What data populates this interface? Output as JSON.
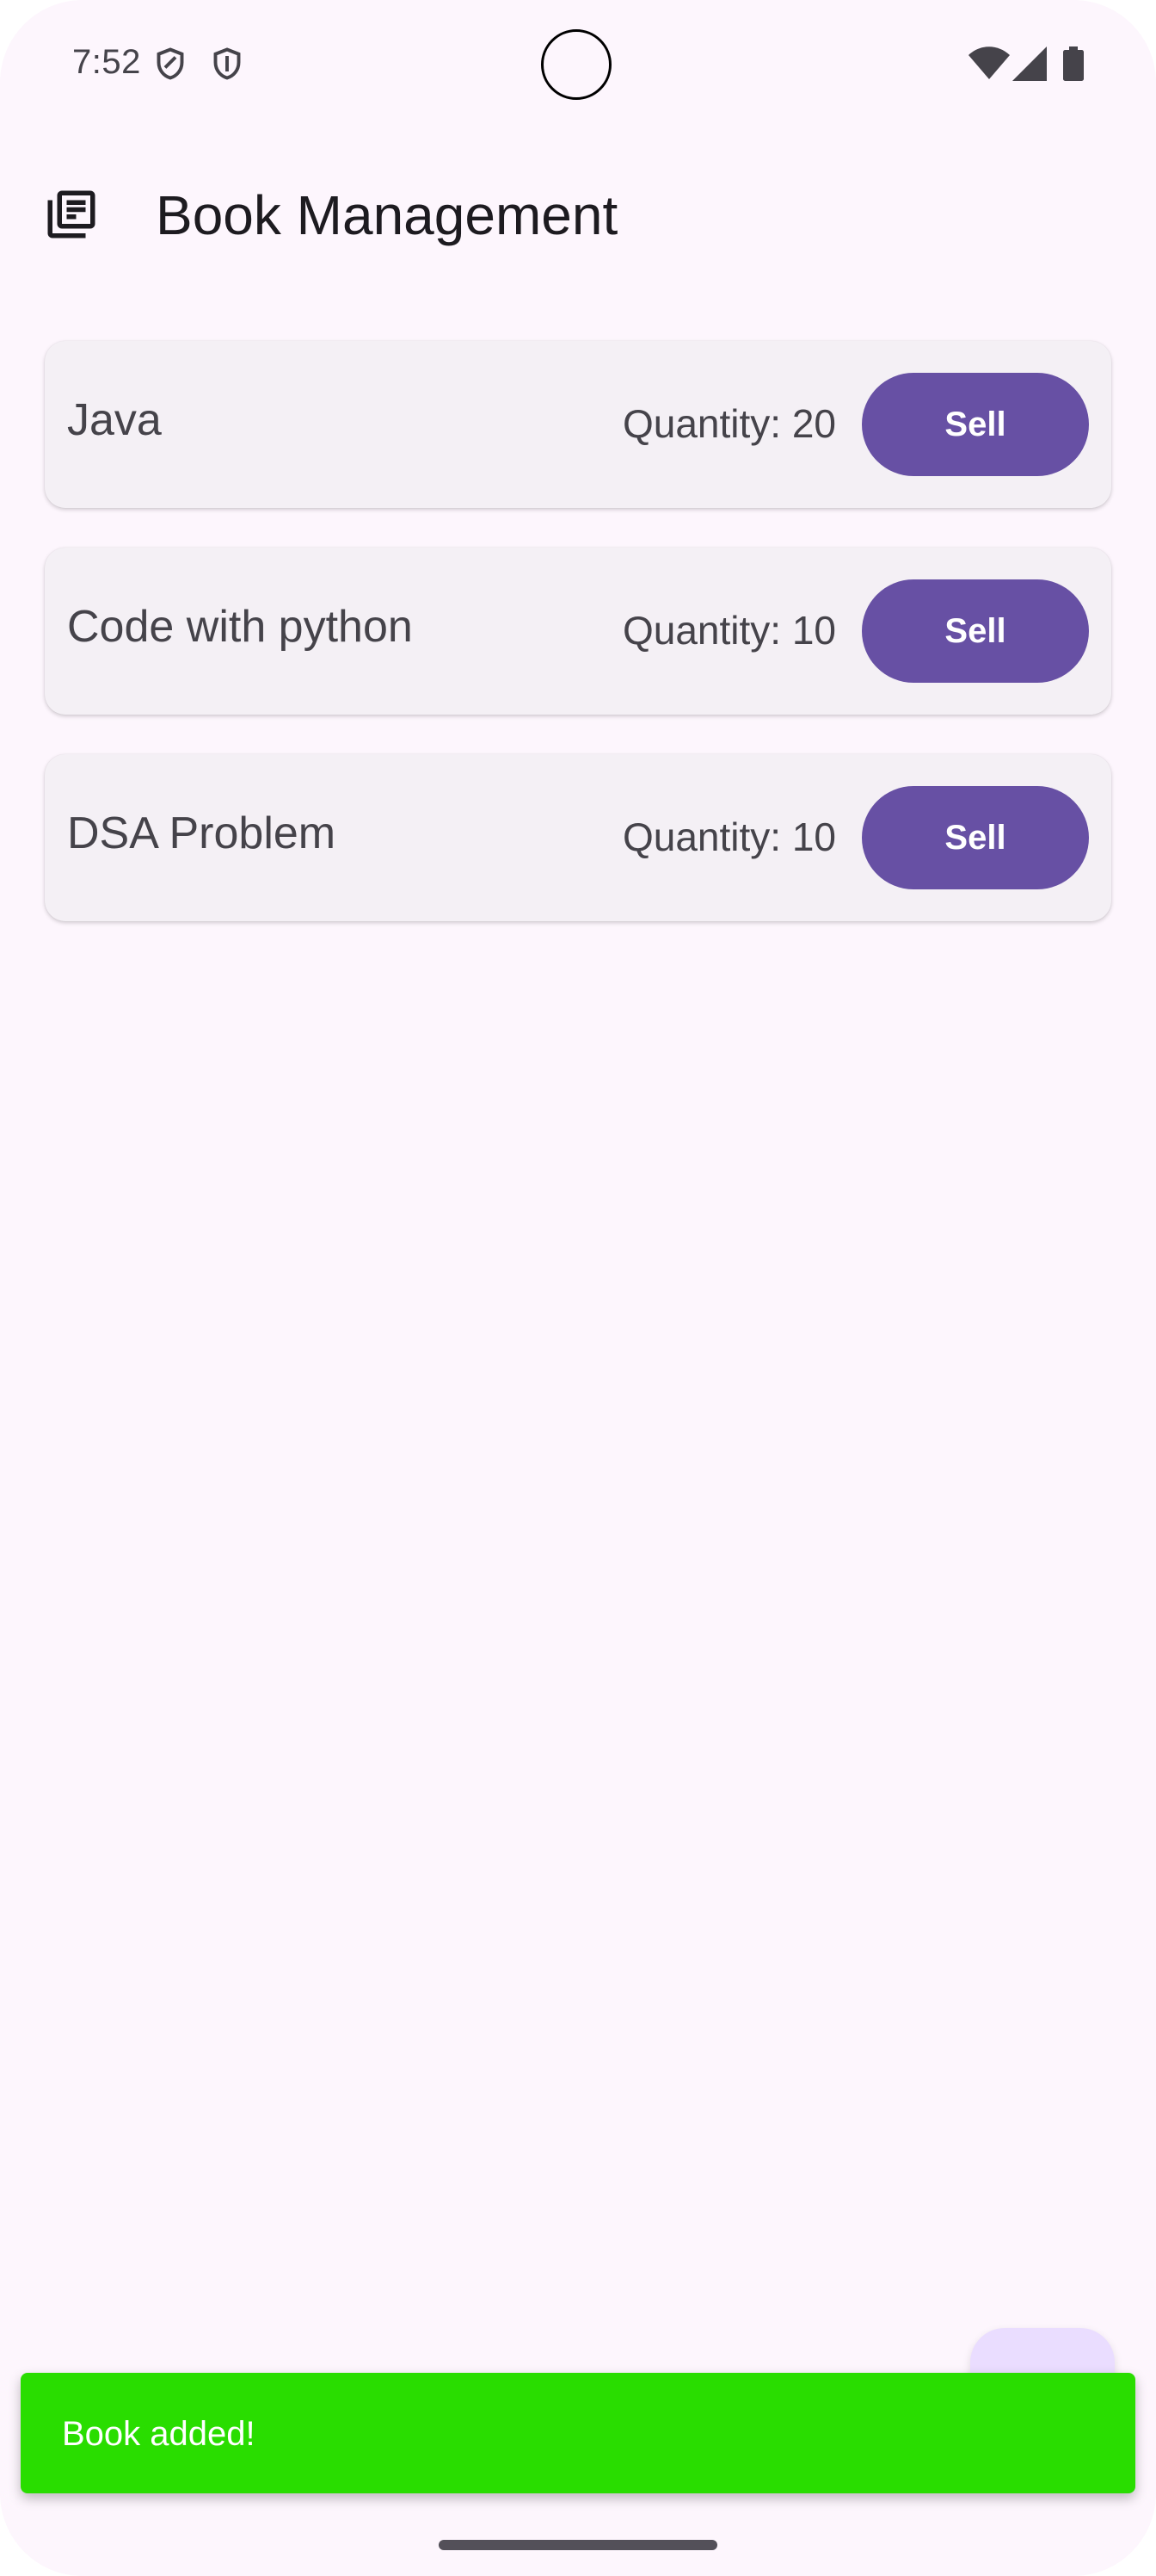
{
  "status_bar": {
    "time": "7:52",
    "left_icons": [
      "shield-icon",
      "shield-icon"
    ],
    "right_icons": [
      "wifi-icon",
      "cellular-signal-icon",
      "battery-icon"
    ]
  },
  "app_bar": {
    "icon": "library-books-icon",
    "title": "Book Management"
  },
  "books": [
    {
      "title": "Java",
      "quantity_label": "Quantity: 20",
      "quantity": 20,
      "sell_label": "Sell"
    },
    {
      "title": "Code with python",
      "quantity_label": "Quantity: 10",
      "quantity": 10,
      "sell_label": "Sell"
    },
    {
      "title": "DSA Problem",
      "quantity_label": "Quantity: 10",
      "quantity": 10,
      "sell_label": "Sell"
    }
  ],
  "snackbar": {
    "message": "Book added!",
    "color": "#29dd00"
  },
  "colors": {
    "background": "#fdf6fd",
    "primary": "#6750a4",
    "card": "#f4f0f5",
    "fab": "#eaddff"
  }
}
